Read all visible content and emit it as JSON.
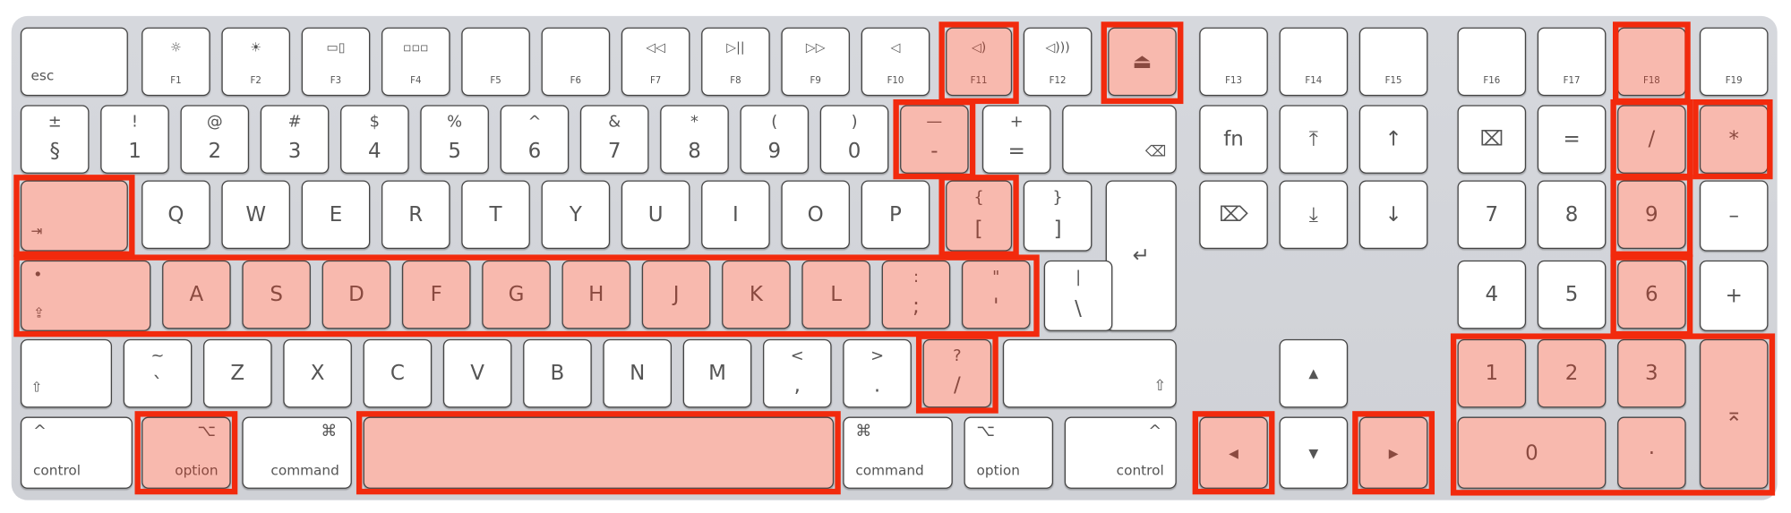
{
  "highlight_color": "#f22a0d",
  "highlight_fill": "#f8b9ae",
  "keys": [
    {
      "id": "esc",
      "a": "esc",
      "t": "bl"
    },
    {
      "id": "f1",
      "a": "☼",
      "b": "F1",
      "t": "f",
      "icon": "brightness-down-icon"
    },
    {
      "id": "f2",
      "a": "☀",
      "b": "F2",
      "t": "f",
      "icon": "brightness-up-icon"
    },
    {
      "id": "f3",
      "a": "▭▯",
      "b": "F3",
      "t": "f",
      "icon": "mission-control-icon"
    },
    {
      "id": "f4",
      "a": "▫▫▫",
      "b": "F4",
      "t": "f",
      "icon": "launchpad-icon"
    },
    {
      "id": "f5",
      "a": "",
      "b": "F5",
      "t": "f"
    },
    {
      "id": "f6",
      "a": "",
      "b": "F6",
      "t": "f"
    },
    {
      "id": "f7",
      "a": "◁◁",
      "b": "F7",
      "t": "f",
      "icon": "rewind-icon"
    },
    {
      "id": "f8",
      "a": "▷||",
      "b": "F8",
      "t": "f",
      "icon": "play-pause-icon"
    },
    {
      "id": "f9",
      "a": "▷▷",
      "b": "F9",
      "t": "f",
      "icon": "fast-forward-icon"
    },
    {
      "id": "f10",
      "a": "◁",
      "b": "F10",
      "t": "f",
      "icon": "mute-icon"
    },
    {
      "id": "f11",
      "a": "◁)",
      "b": "F11",
      "t": "f",
      "icon": "volume-down-icon",
      "hl": true
    },
    {
      "id": "f12",
      "a": "◁)))",
      "b": "F12",
      "t": "f",
      "icon": "volume-up-icon"
    },
    {
      "id": "eject",
      "a": "⏏",
      "t": "c",
      "icon": "eject-icon",
      "hl": true
    },
    {
      "id": "f13",
      "a": "",
      "b": "F13",
      "t": "f"
    },
    {
      "id": "f14",
      "a": "",
      "b": "F14",
      "t": "f"
    },
    {
      "id": "f15",
      "a": "",
      "b": "F15",
      "t": "f"
    },
    {
      "id": "f16",
      "a": "",
      "b": "F16",
      "t": "f"
    },
    {
      "id": "f17",
      "a": "",
      "b": "F17",
      "t": "f"
    },
    {
      "id": "f18",
      "a": "",
      "b": "F18",
      "t": "f",
      "hl": true
    },
    {
      "id": "f19",
      "a": "",
      "b": "F19",
      "t": "f"
    },
    {
      "id": "sect",
      "a": "±",
      "b": "§",
      "t": "tb"
    },
    {
      "id": "k1",
      "a": "!",
      "b": "1",
      "t": "tb"
    },
    {
      "id": "k2",
      "a": "@",
      "b": "2",
      "t": "tb"
    },
    {
      "id": "k3",
      "a": "#",
      "b": "3",
      "t": "tb"
    },
    {
      "id": "k4",
      "a": "$",
      "b": "4",
      "t": "tb"
    },
    {
      "id": "k5",
      "a": "%",
      "b": "5",
      "t": "tb"
    },
    {
      "id": "k6",
      "a": "^",
      "b": "6",
      "t": "tb"
    },
    {
      "id": "k7",
      "a": "&",
      "b": "7",
      "t": "tb"
    },
    {
      "id": "k8",
      "a": "*",
      "b": "8",
      "t": "tb"
    },
    {
      "id": "k9",
      "a": "(",
      "b": "9",
      "t": "tb"
    },
    {
      "id": "k0",
      "a": ")",
      "b": "0",
      "t": "tb"
    },
    {
      "id": "minus",
      "a": "—",
      "b": "-",
      "t": "tb",
      "hl": true
    },
    {
      "id": "equal",
      "a": "+",
      "b": "=",
      "t": "tb"
    },
    {
      "id": "delete",
      "a": "⌫",
      "t": "br",
      "icon": "delete-icon"
    },
    {
      "id": "fn",
      "a": "fn",
      "t": "c"
    },
    {
      "id": "home",
      "a": "⤒",
      "t": "c",
      "icon": "home-icon"
    },
    {
      "id": "pgup",
      "a": "↑",
      "t": "c",
      "icon": "page-up-icon"
    },
    {
      "id": "clear",
      "a": "⌧",
      "t": "c",
      "icon": "clear-icon"
    },
    {
      "id": "npeq",
      "a": "=",
      "t": "c"
    },
    {
      "id": "npdiv",
      "a": "/",
      "t": "c",
      "hl": true
    },
    {
      "id": "npmul",
      "a": "*",
      "t": "c",
      "hl": true
    },
    {
      "id": "tab",
      "a": "⇥",
      "t": "bl",
      "icon": "tab-icon",
      "hl": true
    },
    {
      "id": "q",
      "a": "Q",
      "t": "c"
    },
    {
      "id": "w",
      "a": "W",
      "t": "c"
    },
    {
      "id": "e",
      "a": "E",
      "t": "c"
    },
    {
      "id": "r",
      "a": "R",
      "t": "c"
    },
    {
      "id": "t",
      "a": "T",
      "t": "c"
    },
    {
      "id": "y",
      "a": "Y",
      "t": "c"
    },
    {
      "id": "u",
      "a": "U",
      "t": "c"
    },
    {
      "id": "i",
      "a": "I",
      "t": "c"
    },
    {
      "id": "o",
      "a": "O",
      "t": "c"
    },
    {
      "id": "p",
      "a": "P",
      "t": "c"
    },
    {
      "id": "lbr",
      "a": "{",
      "b": "[",
      "t": "tb",
      "hl": true
    },
    {
      "id": "rbr",
      "a": "}",
      "b": "]",
      "t": "tb"
    },
    {
      "id": "return",
      "a": "↵",
      "t": "c",
      "icon": "return-icon"
    },
    {
      "id": "fdel",
      "a": "⌦",
      "t": "c",
      "icon": "forward-delete-icon"
    },
    {
      "id": "end",
      "a": "⤓",
      "t": "c",
      "icon": "end-icon"
    },
    {
      "id": "pgdn",
      "a": "↓",
      "t": "c",
      "icon": "page-down-icon"
    },
    {
      "id": "n7",
      "a": "7",
      "t": "c"
    },
    {
      "id": "n8",
      "a": "8",
      "t": "c"
    },
    {
      "id": "n9",
      "a": "9",
      "t": "c",
      "hl": true
    },
    {
      "id": "npminus",
      "a": "–",
      "t": "c"
    },
    {
      "id": "caps",
      "a": "•",
      "b": "⇪",
      "t": "mod",
      "icon": "caps-lock-icon",
      "hl": true
    },
    {
      "id": "a",
      "a": "A",
      "t": "c",
      "hl": true
    },
    {
      "id": "s",
      "a": "S",
      "t": "c",
      "hl": true
    },
    {
      "id": "d",
      "a": "D",
      "t": "c",
      "hl": true
    },
    {
      "id": "f",
      "a": "F",
      "t": "c",
      "hl": true
    },
    {
      "id": "g",
      "a": "G",
      "t": "c",
      "hl": true
    },
    {
      "id": "h",
      "a": "H",
      "t": "c",
      "hl": true
    },
    {
      "id": "j",
      "a": "J",
      "t": "c",
      "hl": true
    },
    {
      "id": "k",
      "a": "K",
      "t": "c",
      "hl": true
    },
    {
      "id": "l",
      "a": "L",
      "t": "c",
      "hl": true
    },
    {
      "id": "semi",
      "a": ":",
      "b": ";",
      "t": "tb",
      "hl": true
    },
    {
      "id": "quote",
      "a": "\"",
      "b": "'",
      "t": "tb",
      "hl": true
    },
    {
      "id": "bslash",
      "a": "|",
      "b": "\\",
      "t": "tb"
    },
    {
      "id": "n4",
      "a": "4",
      "t": "c"
    },
    {
      "id": "n5",
      "a": "5",
      "t": "c"
    },
    {
      "id": "n6",
      "a": "6",
      "t": "c",
      "hl": true
    },
    {
      "id": "npplus",
      "a": "+",
      "t": "c"
    },
    {
      "id": "lshift",
      "a": "⇧",
      "t": "bl",
      "icon": "shift-icon"
    },
    {
      "id": "tilde",
      "a": "~",
      "b": "`",
      "t": "tb"
    },
    {
      "id": "z",
      "a": "Z",
      "t": "c"
    },
    {
      "id": "x",
      "a": "X",
      "t": "c"
    },
    {
      "id": "cc",
      "a": "C",
      "t": "c"
    },
    {
      "id": "v",
      "a": "V",
      "t": "c"
    },
    {
      "id": "b",
      "a": "B",
      "t": "c"
    },
    {
      "id": "nn",
      "a": "N",
      "t": "c"
    },
    {
      "id": "m",
      "a": "M",
      "t": "c"
    },
    {
      "id": "lt",
      "a": "<",
      "b": ",",
      "t": "tb"
    },
    {
      "id": "gt",
      "a": ">",
      "b": ".",
      "t": "tb"
    },
    {
      "id": "slash",
      "a": "?",
      "b": "/",
      "t": "tb",
      "hl": true
    },
    {
      "id": "rshift",
      "a": "⇧",
      "t": "br",
      "icon": "shift-icon"
    },
    {
      "id": "up",
      "a": "▲",
      "t": "c sm",
      "icon": "arrow-up-icon"
    },
    {
      "id": "n1",
      "a": "1",
      "t": "c",
      "hl": true
    },
    {
      "id": "n2",
      "a": "2",
      "t": "c",
      "hl": true
    },
    {
      "id": "n3",
      "a": "3",
      "t": "c",
      "hl": true
    },
    {
      "id": "enter",
      "a": "⌅",
      "t": "c",
      "icon": "enter-icon",
      "hl": true
    },
    {
      "id": "lctrl",
      "a": "^",
      "b": "control",
      "t": "mod"
    },
    {
      "id": "lopt",
      "a": "⌥",
      "b": "option",
      "t": "modr",
      "hl": true
    },
    {
      "id": "lcmd",
      "a": "⌘",
      "b": "command",
      "t": "modr"
    },
    {
      "id": "space",
      "a": "",
      "t": "c",
      "hl": true
    },
    {
      "id": "rcmd",
      "a": "⌘",
      "b": "command",
      "t": "mod"
    },
    {
      "id": "ropt",
      "a": "⌥",
      "b": "option",
      "t": "mod"
    },
    {
      "id": "rctrl",
      "a": "^",
      "b": "control",
      "t": "modr"
    },
    {
      "id": "left",
      "a": "◀",
      "t": "c sm",
      "icon": "arrow-left-icon",
      "hl": true
    },
    {
      "id": "down",
      "a": "▼",
      "t": "c sm",
      "icon": "arrow-down-icon"
    },
    {
      "id": "right",
      "a": "▶",
      "t": "c sm",
      "icon": "arrow-right-icon",
      "hl": true
    },
    {
      "id": "n0",
      "a": "0",
      "t": "c",
      "hl": true
    },
    {
      "id": "ndot",
      "a": "·",
      "t": "c",
      "hl": true
    }
  ]
}
